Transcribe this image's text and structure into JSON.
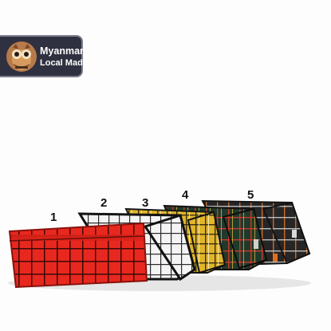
{
  "badge": {
    "line1": "Myanmar",
    "line2": "Local Made",
    "logo_icon": "owl-icon",
    "background_color": "#2f3140"
  },
  "product_numbers": [
    "1",
    "2",
    "3",
    "4",
    "5"
  ],
  "wallets": [
    {
      "number": "1",
      "color": "#e8281e",
      "pattern": "black grid on red"
    },
    {
      "number": "2",
      "color": "#f4f4f4",
      "pattern": "black grid on white"
    },
    {
      "number": "3",
      "color": "#e1b52a",
      "pattern": "black and white grid on mustard"
    },
    {
      "number": "4",
      "color": "#1f3a2a",
      "pattern": "red and yellow grid on dark green"
    },
    {
      "number": "5",
      "color": "#262626",
      "pattern": "orange and white grid on black"
    }
  ]
}
